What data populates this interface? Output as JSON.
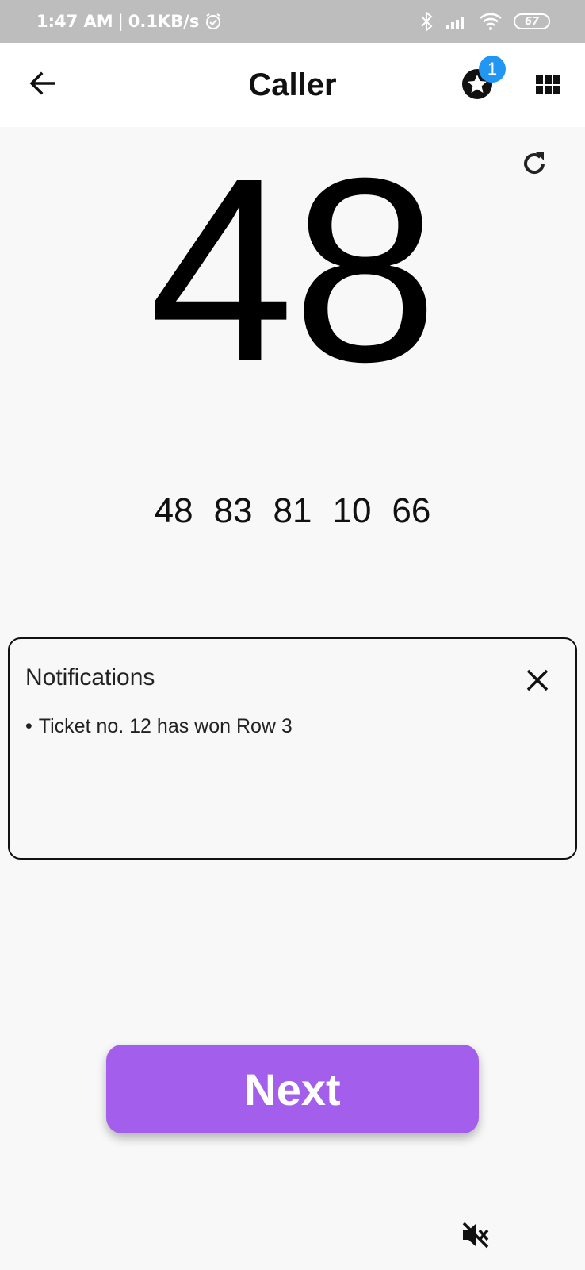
{
  "status_bar": {
    "time": "1:47 AM",
    "separator": "|",
    "speed": "0.1KB/s",
    "battery": "67",
    "icons": [
      "alarm-icon",
      "bluetooth-icon",
      "signal-icon",
      "wifi-icon",
      "battery-icon"
    ]
  },
  "app_bar": {
    "title": "Caller",
    "back_icon": "arrow-back-icon",
    "star_icon": "star-icon",
    "badge_count": "1",
    "grid_icon": "grid-icon"
  },
  "caller": {
    "current_number": "48",
    "history": [
      "48",
      "83",
      "81",
      "10",
      "66"
    ],
    "refresh_icon": "refresh-icon"
  },
  "notifications": {
    "title": "Notifications",
    "close_icon": "close-icon",
    "items": [
      {
        "bullet": "•",
        "text": "Ticket no. 12 has won Row 3"
      }
    ]
  },
  "actions": {
    "next_label": "Next",
    "mute_icon": "volume-off-icon"
  },
  "colors": {
    "status_bar": "#bdbdbd",
    "app_bar": "#ffffff",
    "background": "#f8f8f8",
    "accent": "#a35fec",
    "badge": "#2196f3"
  }
}
